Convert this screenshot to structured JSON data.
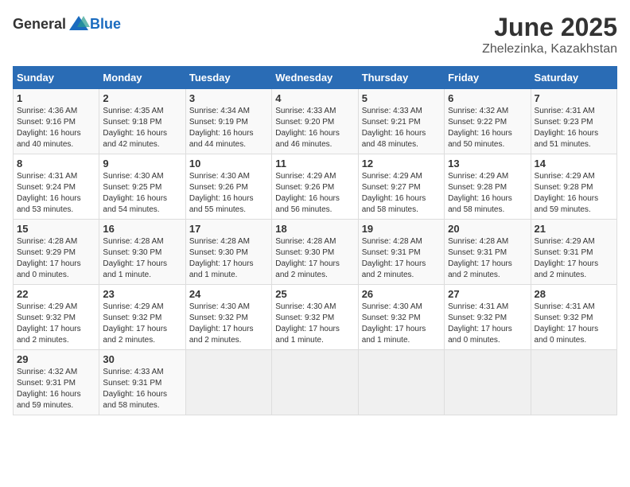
{
  "logo": {
    "general": "General",
    "blue": "Blue"
  },
  "title": "June 2025",
  "location": "Zhelezinka, Kazakhstan",
  "days_of_week": [
    "Sunday",
    "Monday",
    "Tuesday",
    "Wednesday",
    "Thursday",
    "Friday",
    "Saturday"
  ],
  "weeks": [
    [
      {
        "num": "1",
        "sunrise": "4:36 AM",
        "sunset": "9:16 PM",
        "daylight": "16 hours and 40 minutes."
      },
      {
        "num": "2",
        "sunrise": "4:35 AM",
        "sunset": "9:18 PM",
        "daylight": "16 hours and 42 minutes."
      },
      {
        "num": "3",
        "sunrise": "4:34 AM",
        "sunset": "9:19 PM",
        "daylight": "16 hours and 44 minutes."
      },
      {
        "num": "4",
        "sunrise": "4:33 AM",
        "sunset": "9:20 PM",
        "daylight": "16 hours and 46 minutes."
      },
      {
        "num": "5",
        "sunrise": "4:33 AM",
        "sunset": "9:21 PM",
        "daylight": "16 hours and 48 minutes."
      },
      {
        "num": "6",
        "sunrise": "4:32 AM",
        "sunset": "9:22 PM",
        "daylight": "16 hours and 50 minutes."
      },
      {
        "num": "7",
        "sunrise": "4:31 AM",
        "sunset": "9:23 PM",
        "daylight": "16 hours and 51 minutes."
      }
    ],
    [
      {
        "num": "8",
        "sunrise": "4:31 AM",
        "sunset": "9:24 PM",
        "daylight": "16 hours and 53 minutes."
      },
      {
        "num": "9",
        "sunrise": "4:30 AM",
        "sunset": "9:25 PM",
        "daylight": "16 hours and 54 minutes."
      },
      {
        "num": "10",
        "sunrise": "4:30 AM",
        "sunset": "9:26 PM",
        "daylight": "16 hours and 55 minutes."
      },
      {
        "num": "11",
        "sunrise": "4:29 AM",
        "sunset": "9:26 PM",
        "daylight": "16 hours and 56 minutes."
      },
      {
        "num": "12",
        "sunrise": "4:29 AM",
        "sunset": "9:27 PM",
        "daylight": "16 hours and 58 minutes."
      },
      {
        "num": "13",
        "sunrise": "4:29 AM",
        "sunset": "9:28 PM",
        "daylight": "16 hours and 58 minutes."
      },
      {
        "num": "14",
        "sunrise": "4:29 AM",
        "sunset": "9:28 PM",
        "daylight": "16 hours and 59 minutes."
      }
    ],
    [
      {
        "num": "15",
        "sunrise": "4:28 AM",
        "sunset": "9:29 PM",
        "daylight": "17 hours and 0 minutes."
      },
      {
        "num": "16",
        "sunrise": "4:28 AM",
        "sunset": "9:30 PM",
        "daylight": "17 hours and 1 minute."
      },
      {
        "num": "17",
        "sunrise": "4:28 AM",
        "sunset": "9:30 PM",
        "daylight": "17 hours and 1 minute."
      },
      {
        "num": "18",
        "sunrise": "4:28 AM",
        "sunset": "9:30 PM",
        "daylight": "17 hours and 2 minutes."
      },
      {
        "num": "19",
        "sunrise": "4:28 AM",
        "sunset": "9:31 PM",
        "daylight": "17 hours and 2 minutes."
      },
      {
        "num": "20",
        "sunrise": "4:28 AM",
        "sunset": "9:31 PM",
        "daylight": "17 hours and 2 minutes."
      },
      {
        "num": "21",
        "sunrise": "4:29 AM",
        "sunset": "9:31 PM",
        "daylight": "17 hours and 2 minutes."
      }
    ],
    [
      {
        "num": "22",
        "sunrise": "4:29 AM",
        "sunset": "9:32 PM",
        "daylight": "17 hours and 2 minutes."
      },
      {
        "num": "23",
        "sunrise": "4:29 AM",
        "sunset": "9:32 PM",
        "daylight": "17 hours and 2 minutes."
      },
      {
        "num": "24",
        "sunrise": "4:30 AM",
        "sunset": "9:32 PM",
        "daylight": "17 hours and 2 minutes."
      },
      {
        "num": "25",
        "sunrise": "4:30 AM",
        "sunset": "9:32 PM",
        "daylight": "17 hours and 1 minute."
      },
      {
        "num": "26",
        "sunrise": "4:30 AM",
        "sunset": "9:32 PM",
        "daylight": "17 hours and 1 minute."
      },
      {
        "num": "27",
        "sunrise": "4:31 AM",
        "sunset": "9:32 PM",
        "daylight": "17 hours and 0 minutes."
      },
      {
        "num": "28",
        "sunrise": "4:31 AM",
        "sunset": "9:32 PM",
        "daylight": "17 hours and 0 minutes."
      }
    ],
    [
      {
        "num": "29",
        "sunrise": "4:32 AM",
        "sunset": "9:31 PM",
        "daylight": "16 hours and 59 minutes."
      },
      {
        "num": "30",
        "sunrise": "4:33 AM",
        "sunset": "9:31 PM",
        "daylight": "16 hours and 58 minutes."
      },
      null,
      null,
      null,
      null,
      null
    ]
  ]
}
